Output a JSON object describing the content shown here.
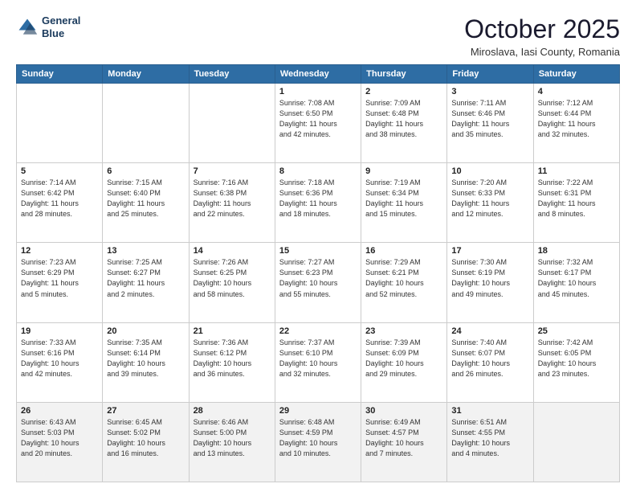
{
  "header": {
    "logo_line1": "General",
    "logo_line2": "Blue",
    "month_title": "October 2025",
    "subtitle": "Miroslava, Iasi County, Romania"
  },
  "weekdays": [
    "Sunday",
    "Monday",
    "Tuesday",
    "Wednesday",
    "Thursday",
    "Friday",
    "Saturday"
  ],
  "weeks": [
    [
      {
        "day": "",
        "info": ""
      },
      {
        "day": "",
        "info": ""
      },
      {
        "day": "",
        "info": ""
      },
      {
        "day": "1",
        "info": "Sunrise: 7:08 AM\nSunset: 6:50 PM\nDaylight: 11 hours\nand 42 minutes."
      },
      {
        "day": "2",
        "info": "Sunrise: 7:09 AM\nSunset: 6:48 PM\nDaylight: 11 hours\nand 38 minutes."
      },
      {
        "day": "3",
        "info": "Sunrise: 7:11 AM\nSunset: 6:46 PM\nDaylight: 11 hours\nand 35 minutes."
      },
      {
        "day": "4",
        "info": "Sunrise: 7:12 AM\nSunset: 6:44 PM\nDaylight: 11 hours\nand 32 minutes."
      }
    ],
    [
      {
        "day": "5",
        "info": "Sunrise: 7:14 AM\nSunset: 6:42 PM\nDaylight: 11 hours\nand 28 minutes."
      },
      {
        "day": "6",
        "info": "Sunrise: 7:15 AM\nSunset: 6:40 PM\nDaylight: 11 hours\nand 25 minutes."
      },
      {
        "day": "7",
        "info": "Sunrise: 7:16 AM\nSunset: 6:38 PM\nDaylight: 11 hours\nand 22 minutes."
      },
      {
        "day": "8",
        "info": "Sunrise: 7:18 AM\nSunset: 6:36 PM\nDaylight: 11 hours\nand 18 minutes."
      },
      {
        "day": "9",
        "info": "Sunrise: 7:19 AM\nSunset: 6:34 PM\nDaylight: 11 hours\nand 15 minutes."
      },
      {
        "day": "10",
        "info": "Sunrise: 7:20 AM\nSunset: 6:33 PM\nDaylight: 11 hours\nand 12 minutes."
      },
      {
        "day": "11",
        "info": "Sunrise: 7:22 AM\nSunset: 6:31 PM\nDaylight: 11 hours\nand 8 minutes."
      }
    ],
    [
      {
        "day": "12",
        "info": "Sunrise: 7:23 AM\nSunset: 6:29 PM\nDaylight: 11 hours\nand 5 minutes."
      },
      {
        "day": "13",
        "info": "Sunrise: 7:25 AM\nSunset: 6:27 PM\nDaylight: 11 hours\nand 2 minutes."
      },
      {
        "day": "14",
        "info": "Sunrise: 7:26 AM\nSunset: 6:25 PM\nDaylight: 10 hours\nand 58 minutes."
      },
      {
        "day": "15",
        "info": "Sunrise: 7:27 AM\nSunset: 6:23 PM\nDaylight: 10 hours\nand 55 minutes."
      },
      {
        "day": "16",
        "info": "Sunrise: 7:29 AM\nSunset: 6:21 PM\nDaylight: 10 hours\nand 52 minutes."
      },
      {
        "day": "17",
        "info": "Sunrise: 7:30 AM\nSunset: 6:19 PM\nDaylight: 10 hours\nand 49 minutes."
      },
      {
        "day": "18",
        "info": "Sunrise: 7:32 AM\nSunset: 6:17 PM\nDaylight: 10 hours\nand 45 minutes."
      }
    ],
    [
      {
        "day": "19",
        "info": "Sunrise: 7:33 AM\nSunset: 6:16 PM\nDaylight: 10 hours\nand 42 minutes."
      },
      {
        "day": "20",
        "info": "Sunrise: 7:35 AM\nSunset: 6:14 PM\nDaylight: 10 hours\nand 39 minutes."
      },
      {
        "day": "21",
        "info": "Sunrise: 7:36 AM\nSunset: 6:12 PM\nDaylight: 10 hours\nand 36 minutes."
      },
      {
        "day": "22",
        "info": "Sunrise: 7:37 AM\nSunset: 6:10 PM\nDaylight: 10 hours\nand 32 minutes."
      },
      {
        "day": "23",
        "info": "Sunrise: 7:39 AM\nSunset: 6:09 PM\nDaylight: 10 hours\nand 29 minutes."
      },
      {
        "day": "24",
        "info": "Sunrise: 7:40 AM\nSunset: 6:07 PM\nDaylight: 10 hours\nand 26 minutes."
      },
      {
        "day": "25",
        "info": "Sunrise: 7:42 AM\nSunset: 6:05 PM\nDaylight: 10 hours\nand 23 minutes."
      }
    ],
    [
      {
        "day": "26",
        "info": "Sunrise: 6:43 AM\nSunset: 5:03 PM\nDaylight: 10 hours\nand 20 minutes."
      },
      {
        "day": "27",
        "info": "Sunrise: 6:45 AM\nSunset: 5:02 PM\nDaylight: 10 hours\nand 16 minutes."
      },
      {
        "day": "28",
        "info": "Sunrise: 6:46 AM\nSunset: 5:00 PM\nDaylight: 10 hours\nand 13 minutes."
      },
      {
        "day": "29",
        "info": "Sunrise: 6:48 AM\nSunset: 4:59 PM\nDaylight: 10 hours\nand 10 minutes."
      },
      {
        "day": "30",
        "info": "Sunrise: 6:49 AM\nSunset: 4:57 PM\nDaylight: 10 hours\nand 7 minutes."
      },
      {
        "day": "31",
        "info": "Sunrise: 6:51 AM\nSunset: 4:55 PM\nDaylight: 10 hours\nand 4 minutes."
      },
      {
        "day": "",
        "info": ""
      }
    ]
  ]
}
